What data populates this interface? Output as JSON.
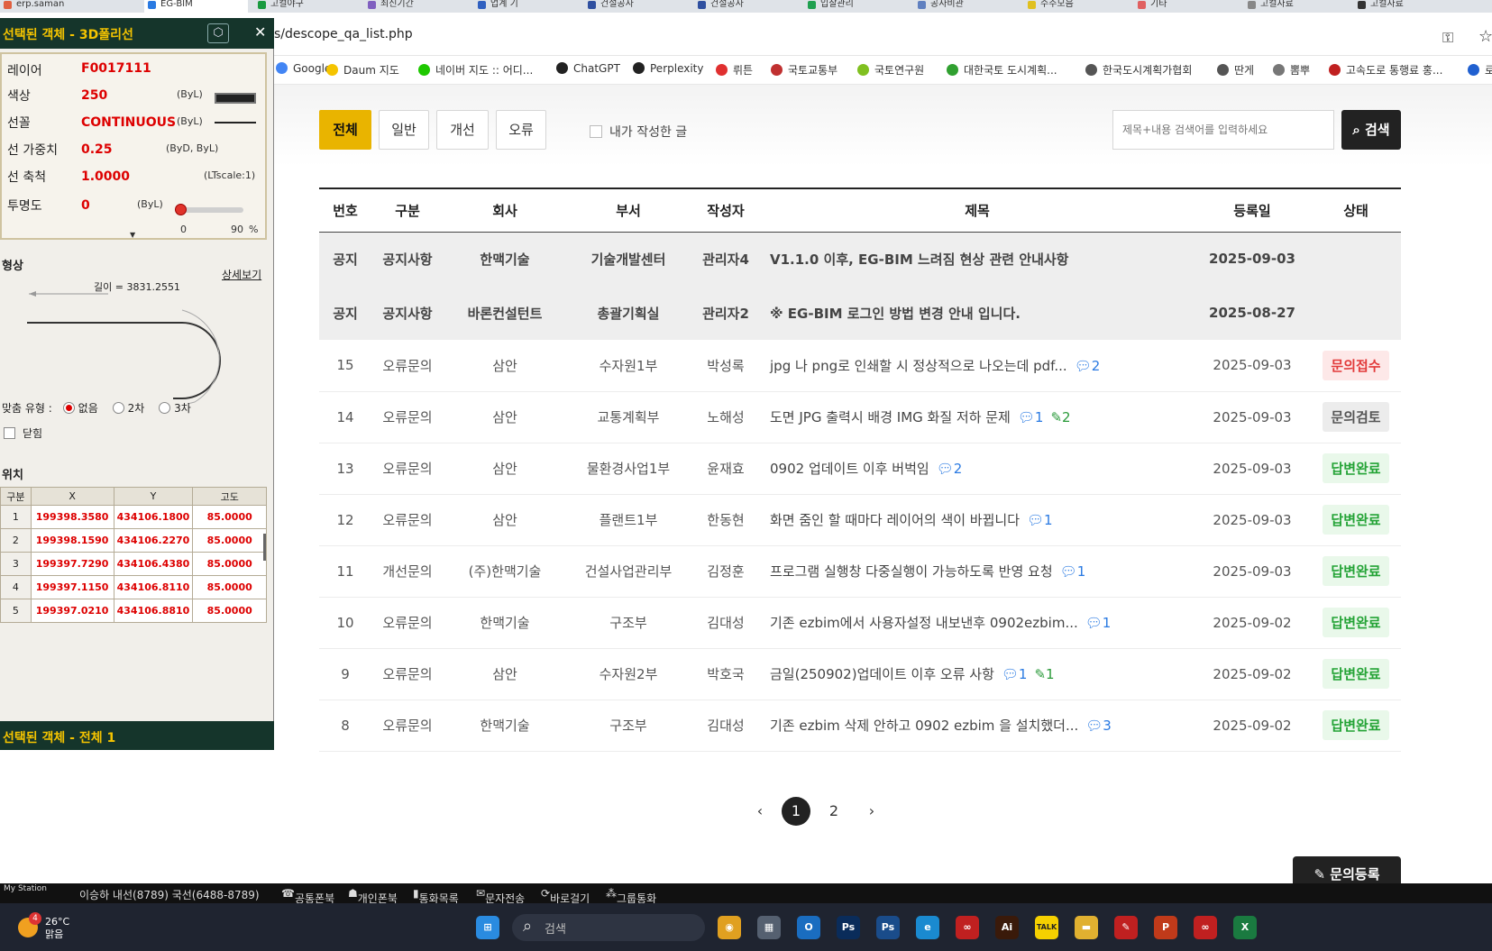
{
  "browser": {
    "tabs": [
      {
        "label": "erp.saman",
        "color": "#e06040"
      },
      {
        "label": "EG-BIM",
        "color": "#2a7ae2"
      },
      {
        "label": "고컬야구",
        "color": "#1a9a40"
      },
      {
        "label": "최신기간",
        "color": "#8060c0"
      },
      {
        "label": "업계 기",
        "color": "#3060c0"
      },
      {
        "label": "건설공사",
        "color": "#3050a0"
      },
      {
        "label": "건설공사",
        "color": "#3050a0"
      },
      {
        "label": "입찰관리",
        "color": "#20a050"
      },
      {
        "label": "공사비관",
        "color": "#6080c0"
      },
      {
        "label": "수주모음",
        "color": "#e0c020"
      },
      {
        "label": "기타",
        "color": "#e06060"
      },
      {
        "label": "고컬자료",
        "color": "#888888"
      },
      {
        "label": "고컬자료",
        "color": "#333333"
      }
    ],
    "url": "s/descope_qa_list.php",
    "bookmarks": [
      {
        "label": "Google",
        "color": "#4285f4"
      },
      {
        "label": "Daum 지도",
        "color": "#f5c400"
      },
      {
        "label": "네이버 지도 :: 어디...",
        "color": "#1ec800"
      },
      {
        "label": "ChatGPT",
        "color": "#222222"
      },
      {
        "label": "Perplexity",
        "color": "#222222"
      },
      {
        "label": "뤼튼",
        "color": "#e03030"
      },
      {
        "label": "국토교통부",
        "color": "#c03030"
      },
      {
        "label": "국토연구원",
        "color": "#80c020"
      },
      {
        "label": "대한국토 도시계획...",
        "color": "#30a030"
      },
      {
        "label": "한국도시계획가협회",
        "color": "#555555"
      },
      {
        "label": "딴게",
        "color": "#555555"
      },
      {
        "label": "뽐뿌",
        "color": "#777777"
      },
      {
        "label": "고속도로 통행료 홍...",
        "color": "#c02020"
      },
      {
        "label": "로",
        "color": "#2060d0"
      }
    ]
  },
  "filters": {
    "tabs": [
      "전체",
      "일반",
      "개선",
      "오류"
    ],
    "mine_label": "내가 작성한 글",
    "search_placeholder": "제목+내용 검색어를 입력하세요",
    "search_button": "검색"
  },
  "table": {
    "headers": [
      "번호",
      "구분",
      "회사",
      "부서",
      "작성자",
      "제목",
      "등록일",
      "상태"
    ],
    "notices": [
      {
        "no": "공지",
        "category": "공지사항",
        "company": "한맥기술",
        "dept": "기술개발센터",
        "author": "관리자4",
        "title": "V1.1.0 이후, EG-BIM 느려짐 현상 관련 안내사항",
        "date": "2025-09-03"
      },
      {
        "no": "공지",
        "category": "공지사항",
        "company": "바론컨설턴트",
        "dept": "총괄기획실",
        "author": "관리자2",
        "title": "※ EG-BIM 로그인 방법 변경 안내 입니다.",
        "date": "2025-08-27"
      }
    ],
    "rows": [
      {
        "no": "15",
        "category": "오류문의",
        "company": "삼안",
        "dept": "수자원1부",
        "author": "박성록",
        "title": "jpg 나 png로 인쇄할 시 정상적으로 나오는데 pdf...",
        "comments": "2",
        "attachments": "",
        "date": "2025-09-03",
        "status": "문의접수",
        "status_type": "recv"
      },
      {
        "no": "14",
        "category": "오류문의",
        "company": "삼안",
        "dept": "교통계획부",
        "author": "노해성",
        "title": "도면 JPG 출력시 배경 IMG 화질 저하 문제",
        "comments": "1",
        "attachments": "2",
        "date": "2025-09-03",
        "status": "문의검토",
        "status_type": "review"
      },
      {
        "no": "13",
        "category": "오류문의",
        "company": "삼안",
        "dept": "물환경사업1부",
        "author": "윤재효",
        "title": "0902 업데이트 이후 버벅임",
        "comments": "2",
        "attachments": "",
        "date": "2025-09-03",
        "status": "답변완료",
        "status_type": "done"
      },
      {
        "no": "12",
        "category": "오류문의",
        "company": "삼안",
        "dept": "플랜트1부",
        "author": "한동현",
        "title": "화면 줌인 할 때마다 레이어의 색이 바뀝니다",
        "comments": "1",
        "attachments": "",
        "date": "2025-09-03",
        "status": "답변완료",
        "status_type": "done"
      },
      {
        "no": "11",
        "category": "개선문의",
        "company": "(주)한맥기술",
        "dept": "건설사업관리부",
        "author": "김정훈",
        "title": "프로그램 실행창 다중실행이 가능하도록 반영 요청",
        "comments": "1",
        "attachments": "",
        "date": "2025-09-03",
        "status": "답변완료",
        "status_type": "done"
      },
      {
        "no": "10",
        "category": "오류문의",
        "company": "한맥기술",
        "dept": "구조부",
        "author": "김대성",
        "title": "기존 ezbim에서 사용자설정 내보낸후 0902ezbim...",
        "comments": "1",
        "attachments": "",
        "date": "2025-09-02",
        "status": "답변완료",
        "status_type": "done"
      },
      {
        "no": "9",
        "category": "오류문의",
        "company": "삼안",
        "dept": "수자원2부",
        "author": "박호국",
        "title": "금일(250902)업데이트 이후 오류 사항",
        "comments": "1",
        "attachments": "1",
        "date": "2025-09-02",
        "status": "답변완료",
        "status_type": "done"
      },
      {
        "no": "8",
        "category": "오류문의",
        "company": "한맥기술",
        "dept": "구조부",
        "author": "김대성",
        "title": "기존 ezbim 삭제 안하고 0902 ezbim 을 설치했더...",
        "comments": "3",
        "attachments": "",
        "date": "2025-09-02",
        "status": "답변완료",
        "status_type": "done"
      }
    ]
  },
  "pagination": {
    "prev": "‹",
    "pages": [
      "1",
      "2"
    ],
    "current": "1",
    "next": "›"
  },
  "write_button": "문의등록",
  "panel": {
    "title": "선택된 객체 - 3D폴리선",
    "props": [
      {
        "label": "레이어",
        "value": "F0017111",
        "note": ""
      },
      {
        "label": "색상",
        "value": "250",
        "note": "(ByL)"
      },
      {
        "label": "선꼴",
        "value": "CONTINUOUS",
        "note": "(ByL)"
      },
      {
        "label": "선 가중치",
        "value": "0.25",
        "note": "(ByD, ByL)"
      },
      {
        "label": "선 축척",
        "value": "1.0000",
        "note": "(LTscale:1)"
      },
      {
        "label": "투명도",
        "value": "0",
        "note": "(ByL)"
      }
    ],
    "transparency_min": "0",
    "transparency_max": "90",
    "transparency_unit": "%",
    "transparency_level": 0,
    "shape_title": "형상",
    "detail_link": "상세보기",
    "length_label": "길이 = 3831.2551",
    "fit_label": "맞춤 유형 :",
    "fit_options": [
      "없음",
      "2차",
      "3차"
    ],
    "closed_label": "닫힘",
    "position_title": "위치",
    "pos_headers": [
      "구분",
      "X",
      "Y",
      "고도"
    ],
    "positions": [
      {
        "idx": "1",
        "x": "199398.3580",
        "y": "434106.1800",
        "z": "85.0000"
      },
      {
        "idx": "2",
        "x": "199398.1590",
        "y": "434106.2270",
        "z": "85.0000"
      },
      {
        "idx": "3",
        "x": "199397.7290",
        "y": "434106.4380",
        "z": "85.0000"
      },
      {
        "idx": "4",
        "x": "199397.1150",
        "y": "434106.8110",
        "z": "85.0000"
      },
      {
        "idx": "5",
        "x": "199397.0210",
        "y": "434106.8810",
        "z": "85.0000"
      }
    ],
    "footer": "선택된 객체 - 전체 1"
  },
  "phonebar": {
    "station": "My Station",
    "line": "이승하 내선(8789) 국선(6488-8789)",
    "items": [
      "공통폰북",
      "개인폰북",
      "통화목록",
      "문자전송",
      "바로걸기",
      "그룹통화"
    ]
  },
  "taskbar": {
    "weather_temp": "26°C",
    "weather_desc": "맑음",
    "weather_badge": "4",
    "search_placeholder": "검색",
    "apps": [
      {
        "name": "windows-start",
        "label": "⊞",
        "color": "#2a8be0"
      },
      {
        "name": "chrome",
        "label": "◉",
        "color": "#e0a020"
      },
      {
        "name": "calculator",
        "label": "▦",
        "color": "#556070"
      },
      {
        "name": "outlook",
        "label": "O",
        "color": "#1a6dc0"
      },
      {
        "name": "photoshop",
        "label": "Ps",
        "color": "#0a2c5a"
      },
      {
        "name": "photoshop-2",
        "label": "Ps",
        "color": "#1a4c8a"
      },
      {
        "name": "edge",
        "label": "e",
        "color": "#1a8ad0"
      },
      {
        "name": "app-red",
        "label": "∞",
        "color": "#c02020"
      },
      {
        "name": "illustrator",
        "label": "Ai",
        "color": "#3a1a0a"
      },
      {
        "name": "kakaotalk",
        "label": "TALK",
        "color": "#f5d000"
      },
      {
        "name": "file-explorer",
        "label": "▬",
        "color": "#e0b030"
      },
      {
        "name": "app-red-2",
        "label": "✎",
        "color": "#c02020"
      },
      {
        "name": "powerpoint",
        "label": "P",
        "color": "#c03a1a"
      },
      {
        "name": "app-red-3",
        "label": "∞",
        "color": "#c02020"
      },
      {
        "name": "excel",
        "label": "X",
        "color": "#1a7a40"
      }
    ]
  }
}
